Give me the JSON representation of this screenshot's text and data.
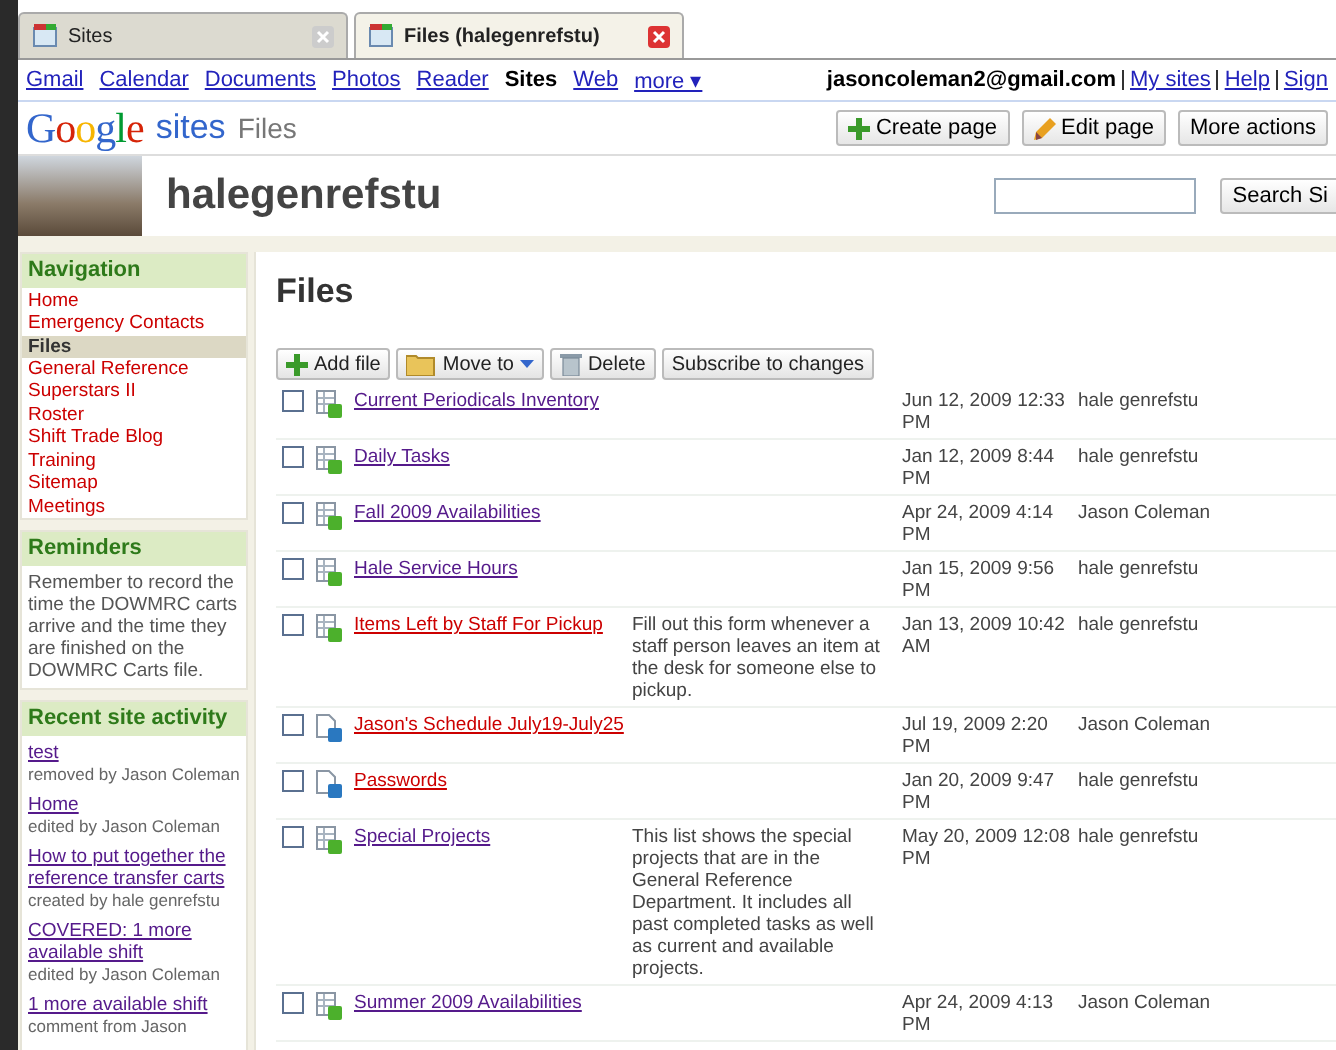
{
  "browser_tabs": [
    {
      "title": "Sites",
      "selected": false
    },
    {
      "title": "Files (halegenrefstu)",
      "selected": true
    }
  ],
  "google_bar": {
    "links": [
      {
        "label": "Gmail",
        "current": false
      },
      {
        "label": "Calendar",
        "current": false
      },
      {
        "label": "Documents",
        "current": false
      },
      {
        "label": "Photos",
        "current": false
      },
      {
        "label": "Reader",
        "current": false
      },
      {
        "label": "Sites",
        "current": true
      },
      {
        "label": "Web",
        "current": false
      },
      {
        "label": "more ▾",
        "current": false
      }
    ],
    "account": "jasoncoleman2@gmail.com",
    "account_links": [
      "My sites",
      "Help",
      "Sign"
    ]
  },
  "header": {
    "logo": "Google",
    "product": "sites",
    "page": "Files",
    "buttons": [
      {
        "label": "Create page",
        "kind": "plus"
      },
      {
        "label": "Edit page",
        "kind": "pencil"
      },
      {
        "label": "More actions",
        "kind": "plain"
      }
    ]
  },
  "site": {
    "title": "halegenrefstu",
    "search_button": "Search Si"
  },
  "sidebar": {
    "navigation": {
      "title": "Navigation",
      "items": [
        {
          "label": "Home",
          "selected": false
        },
        {
          "label": "Emergency Contacts",
          "selected": false
        },
        {
          "label": "Files",
          "selected": true
        },
        {
          "label": "General Reference Superstars II",
          "selected": false
        },
        {
          "label": "Roster",
          "selected": false
        },
        {
          "label": "Shift Trade Blog",
          "selected": false
        },
        {
          "label": "Training",
          "selected": false
        },
        {
          "label": "Sitemap",
          "selected": false
        },
        {
          "label": "Meetings",
          "selected": false
        }
      ]
    },
    "reminders": {
      "title": "Reminders",
      "text": "Remember to record the time the DOWMRC carts arrive and the time they are finished on the DOWMRC Carts file."
    },
    "recent": {
      "title": "Recent site activity",
      "items": [
        {
          "link": "test",
          "note": "removed by Jason Coleman"
        },
        {
          "link": "Home",
          "note": "edited by Jason Coleman"
        },
        {
          "link": "How to put together the reference transfer carts",
          "note": "created by hale genrefstu"
        },
        {
          "link": "COVERED: 1 more available shift",
          "note": "edited by Jason Coleman"
        },
        {
          "link": "1 more available shift",
          "note": "comment from Jason"
        }
      ]
    }
  },
  "main": {
    "title": "Files",
    "toolbar": [
      {
        "label": "Add file",
        "kind": "plus"
      },
      {
        "label": "Move to",
        "kind": "folder"
      },
      {
        "label": "Delete",
        "kind": "trash"
      },
      {
        "label": "Subscribe to changes",
        "kind": "plain"
      }
    ],
    "files": [
      {
        "name": "Current Periodicals Inventory",
        "kind": "sheet",
        "visited": true,
        "checked": false,
        "date": "Jun 12, 2009 12:33 PM",
        "author": "hale genrefstu"
      },
      {
        "name": "Daily Tasks",
        "kind": "sheet",
        "visited": true,
        "checked": false,
        "date": "Jan 12, 2009 8:44 PM",
        "author": "hale genrefstu"
      },
      {
        "name": "Fall 2009 Availabilities",
        "kind": "sheet",
        "visited": true,
        "checked": false,
        "date": "Apr 24, 2009 4:14 PM",
        "author": "Jason Coleman"
      },
      {
        "name": "Hale Service Hours",
        "kind": "sheet",
        "visited": true,
        "checked": false,
        "date": "Jan 15, 2009 9:56 PM",
        "author": "hale genrefstu"
      },
      {
        "name": "Items Left by Staff For Pickup",
        "kind": "sheet",
        "visited": false,
        "checked": false,
        "description": "Fill out this form whenever a staff person leaves an item at the desk for someone else to pickup.",
        "date": "Jan 13, 2009 10:42 AM",
        "author": "hale genrefstu"
      },
      {
        "name": "Jason's Schedule July19-July25",
        "kind": "doc",
        "visited": false,
        "checked": false,
        "date": "Jul 19, 2009 2:20 PM",
        "author": "Jason Coleman"
      },
      {
        "name": "Passwords",
        "kind": "doc",
        "visited": false,
        "checked": false,
        "date": "Jan 20, 2009 9:47 PM",
        "author": "hale genrefstu"
      },
      {
        "name": "Special Projects",
        "kind": "sheet",
        "visited": true,
        "checked": false,
        "description": "This list shows the special projects that are in the General Reference Department. It includes all past completed tasks as well as current and available projects.",
        "date": "May 20, 2009 12:08 PM",
        "author": "hale genrefstu"
      },
      {
        "name": "Summer 2009 Availabilities",
        "kind": "sheet",
        "visited": true,
        "checked": false,
        "date": "Apr 24, 2009 4:13 PM",
        "author": "Jason Coleman"
      }
    ]
  }
}
